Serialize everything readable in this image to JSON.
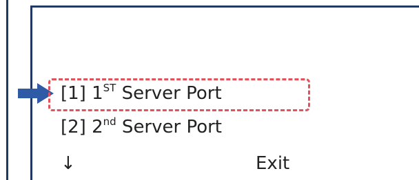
{
  "menu": {
    "items": [
      {
        "prefix": "[1] 1",
        "sup": "ST",
        "suffix": " Server Port"
      },
      {
        "prefix": "[2] 2",
        "sup": "nd",
        "suffix": " Server Port"
      }
    ],
    "down_arrow": "↓",
    "exit_label": "Exit"
  },
  "colors": {
    "frame": "#1f3864",
    "arrow": "#2e5aa6",
    "highlight": "#e0525c"
  },
  "icons": {
    "pointer": "right-arrow-icon",
    "scroll": "down-arrow-icon"
  }
}
